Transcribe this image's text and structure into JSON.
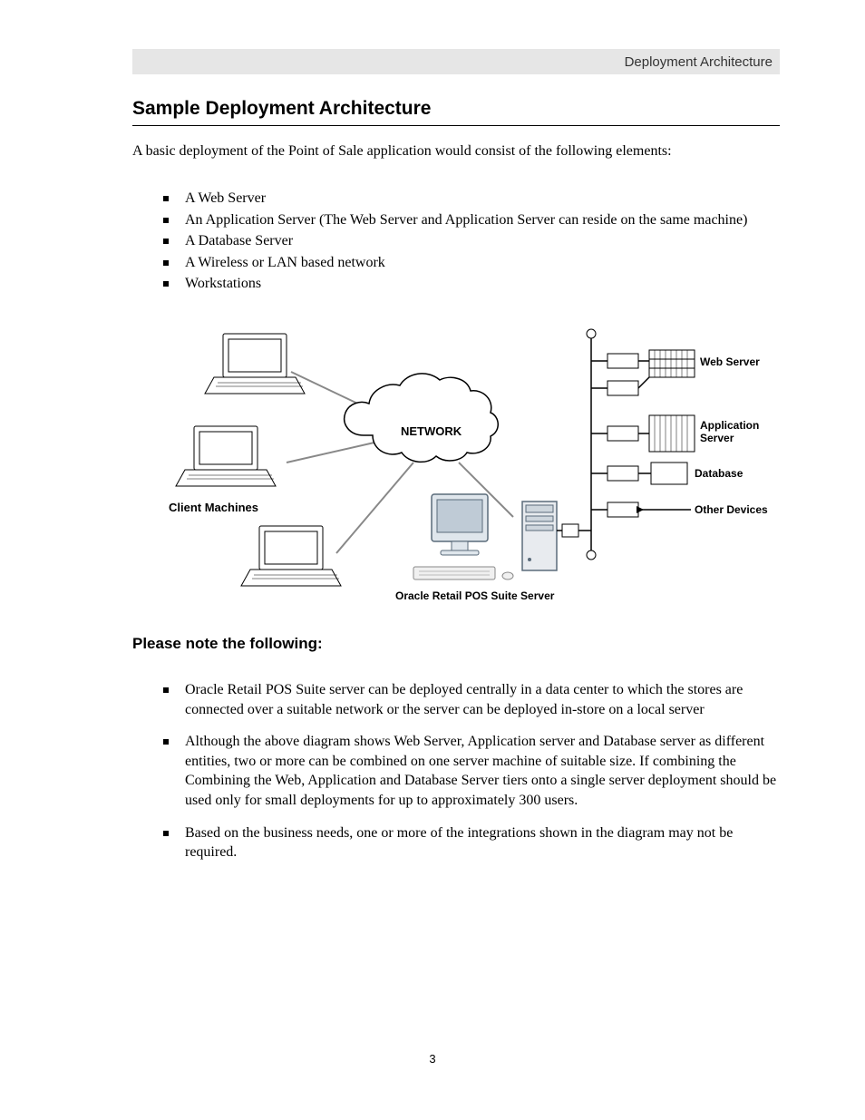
{
  "header": {
    "running_title": "Deployment Architecture"
  },
  "title": "Sample Deployment Architecture",
  "intro": "A basic deployment of the Point of Sale application would consist of the following elements:",
  "hardware_list": [
    "A Web Server",
    "An Application Server (The Web Server and Application Server can reside on the same machine)",
    "A Database Server",
    "A Wireless or LAN based network",
    "Workstations"
  ],
  "diagram": {
    "cloud_label": "NETWORK",
    "client_label": "Client Machines",
    "server_label": "Oracle Retail POS Suite Server",
    "web_label": "Web Server",
    "app_label": "Application Server",
    "db_label": "Database",
    "other_label": "Other Devices"
  },
  "list2_heading": "Please note the following:",
  "notes": [
    "Oracle Retail POS Suite server can be deployed centrally in a data center to which the stores are connected over a suitable network or the server can be deployed in-store on a local server",
    "Although the above diagram shows Web Server, Application server and Database server as different entities, two or more can be combined on one server machine of suitable size. If combining the Combining the Web, Application and Database Server tiers onto a single server deployment should be used only for small deployments for up to approximately 300 users.",
    "Based on the business needs, one or more of the integrations shown in the diagram may not be required."
  ],
  "page_number": "3"
}
